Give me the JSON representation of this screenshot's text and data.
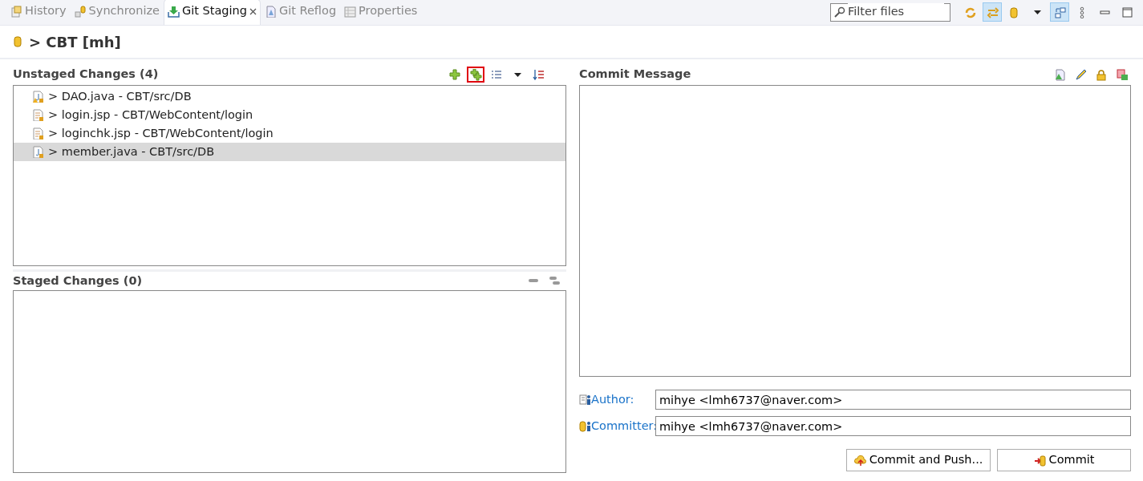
{
  "tabs": [
    {
      "label": "History",
      "kind": "history",
      "selected": false,
      "closable": false
    },
    {
      "label": "Synchronize",
      "kind": "sync",
      "selected": false,
      "closable": false
    },
    {
      "label": "Git Staging",
      "kind": "staging",
      "selected": true,
      "closable": true
    },
    {
      "label": "Git Reflog",
      "kind": "reflog",
      "selected": false,
      "closable": false
    },
    {
      "label": "Properties",
      "kind": "properties",
      "selected": false,
      "closable": false
    }
  ],
  "view_toolbar": {
    "filter": {
      "placeholder": "Filter files"
    },
    "buttons": [
      {
        "kind": "refresh",
        "pressed": false
      },
      {
        "kind": "link",
        "pressed": true
      },
      {
        "kind": "repo",
        "pressed": false
      },
      {
        "kind": "dropdown",
        "pressed": false
      },
      {
        "kind": "layout",
        "pressed": true
      },
      {
        "kind": "more",
        "pressed": false
      },
      {
        "kind": "minimize",
        "pressed": false
      },
      {
        "kind": "maximize",
        "pressed": false
      }
    ]
  },
  "repository": {
    "title": "> CBT [mh]"
  },
  "unstaged": {
    "title": "Unstaged Changes (4)",
    "tools": [
      {
        "kind": "add",
        "highlighted": false
      },
      {
        "kind": "add-all",
        "highlighted": true
      },
      {
        "kind": "list",
        "highlighted": false
      },
      {
        "kind": "dropdown",
        "highlighted": false
      },
      {
        "kind": "sort",
        "highlighted": false
      }
    ],
    "files": [
      {
        "label": "> DAO.java - CBT/src/DB",
        "kind": "java-warning",
        "selected": false
      },
      {
        "label": "> login.jsp - CBT/WebContent/login",
        "kind": "jsp",
        "selected": false
      },
      {
        "label": "> loginchk.jsp - CBT/WebContent/login",
        "kind": "jsp",
        "selected": false
      },
      {
        "label": "> member.java - CBT/src/DB",
        "kind": "java",
        "selected": true
      }
    ]
  },
  "staged": {
    "title": "Staged Changes (0)",
    "tools": [
      {
        "kind": "remove",
        "highlighted": false
      },
      {
        "kind": "remove-all",
        "highlighted": false
      }
    ]
  },
  "commit": {
    "title": "Commit Message",
    "tools": [
      {
        "kind": "sign",
        "highlighted": false
      },
      {
        "kind": "edit",
        "highlighted": false
      },
      {
        "kind": "lock",
        "highlighted": false
      },
      {
        "kind": "amend",
        "highlighted": false
      }
    ],
    "author": {
      "label": "Author:",
      "value": "mihye <lmh6737@naver.com>"
    },
    "committer": {
      "label": "Committer:",
      "value": "mihye <lmh6737@naver.com>"
    },
    "buttons": [
      {
        "label": "Commit and Push...",
        "kind": "push"
      },
      {
        "label": "Commit",
        "kind": "commit"
      }
    ]
  }
}
